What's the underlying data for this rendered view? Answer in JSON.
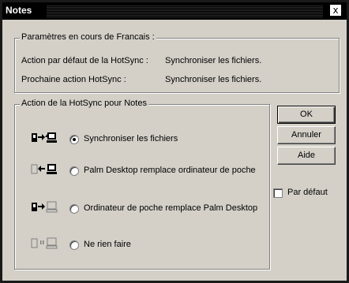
{
  "window": {
    "title": "Notes",
    "close_label": "x"
  },
  "settings": {
    "legend": "Paramètres en cours de Francais :",
    "line1_label": "Action par défaut de la HotSync :",
    "line1_value": "Synchroniser les fichiers.",
    "line2_label": "Prochaine action HotSync :",
    "line2_value": "Synchroniser les fichiers."
  },
  "actions": {
    "legend": "Action de la HotSync pour Notes",
    "options": [
      {
        "label": "Synchroniser les fichiers",
        "selected": true,
        "icon": "sync-both-icon"
      },
      {
        "label": "Palm Desktop remplace ordinateur de poche",
        "selected": false,
        "icon": "desktop-overwrites-handheld-icon"
      },
      {
        "label": "Ordinateur de poche remplace Palm Desktop",
        "selected": false,
        "icon": "handheld-overwrites-desktop-icon"
      },
      {
        "label": "Ne rien faire",
        "selected": false,
        "icon": "do-nothing-icon"
      }
    ]
  },
  "buttons": {
    "ok": "OK",
    "cancel": "Annuler",
    "help": "Aide"
  },
  "default_checkbox": {
    "label": "Par défaut",
    "checked": false
  }
}
